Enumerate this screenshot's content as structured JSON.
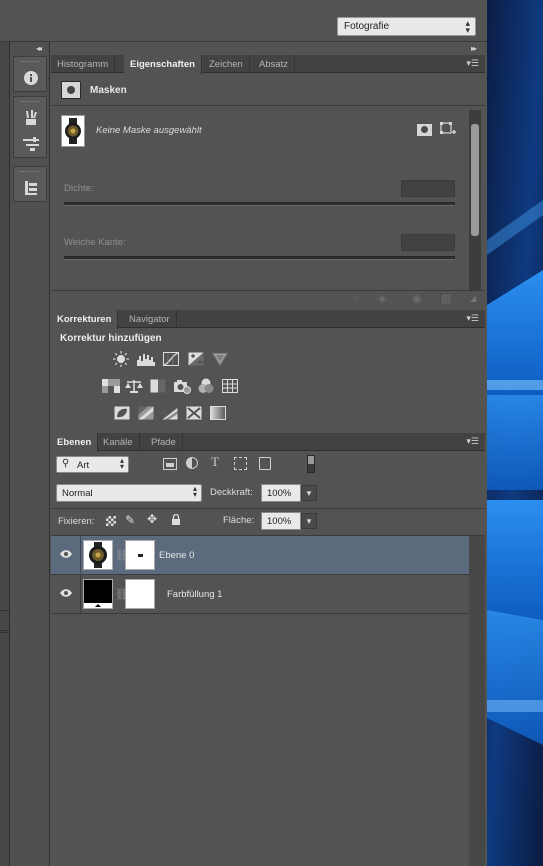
{
  "workspace": {
    "selected": "Fotografie"
  },
  "properties_panel": {
    "tabs": [
      "Histogramm",
      "Eigenschaften",
      "Zeichen",
      "Absatz"
    ],
    "active_tab": "Eigenschaften",
    "section_title": "Masken",
    "mask_status": "Keine Maske ausgewählt",
    "density_label": "Dichte:",
    "feather_label": "Weiche Kante:"
  },
  "adjustments_panel": {
    "tabs": [
      "Korrekturen",
      "Navigator"
    ],
    "active_tab": "Korrekturen",
    "title": "Korrektur hinzufügen",
    "row1_icons": [
      "brightness-contrast-icon",
      "levels-icon",
      "curves-icon",
      "exposure-icon",
      "vibrance-icon"
    ],
    "row2_icons": [
      "hue-saturation-icon",
      "color-balance-icon",
      "black-white-icon",
      "photo-filter-icon",
      "channel-mixer-icon",
      "color-lookup-icon"
    ],
    "row3_icons": [
      "invert-icon",
      "posterize-icon",
      "threshold-icon",
      "selective-color-icon",
      "gradient-map-icon"
    ]
  },
  "layers_panel": {
    "tabs": [
      "Ebenen",
      "Kanäle",
      "Pfade"
    ],
    "active_tab": "Ebenen",
    "filter_kind": "Art",
    "blend_mode": "Normal",
    "opacity_label": "Deckkraft:",
    "opacity_value": "100%",
    "lock_label": "Fixieren:",
    "fill_label": "Fläche:",
    "fill_value": "100%",
    "layers": [
      {
        "name": "Ebene 0",
        "selected": true,
        "visible": true
      },
      {
        "name": "Farbfüllung 1",
        "selected": false,
        "visible": true
      }
    ]
  },
  "colors": {
    "panel_bg": "#535353",
    "selected_layer": "#5b6a7d",
    "desktop_blue": "#1e88e5"
  }
}
